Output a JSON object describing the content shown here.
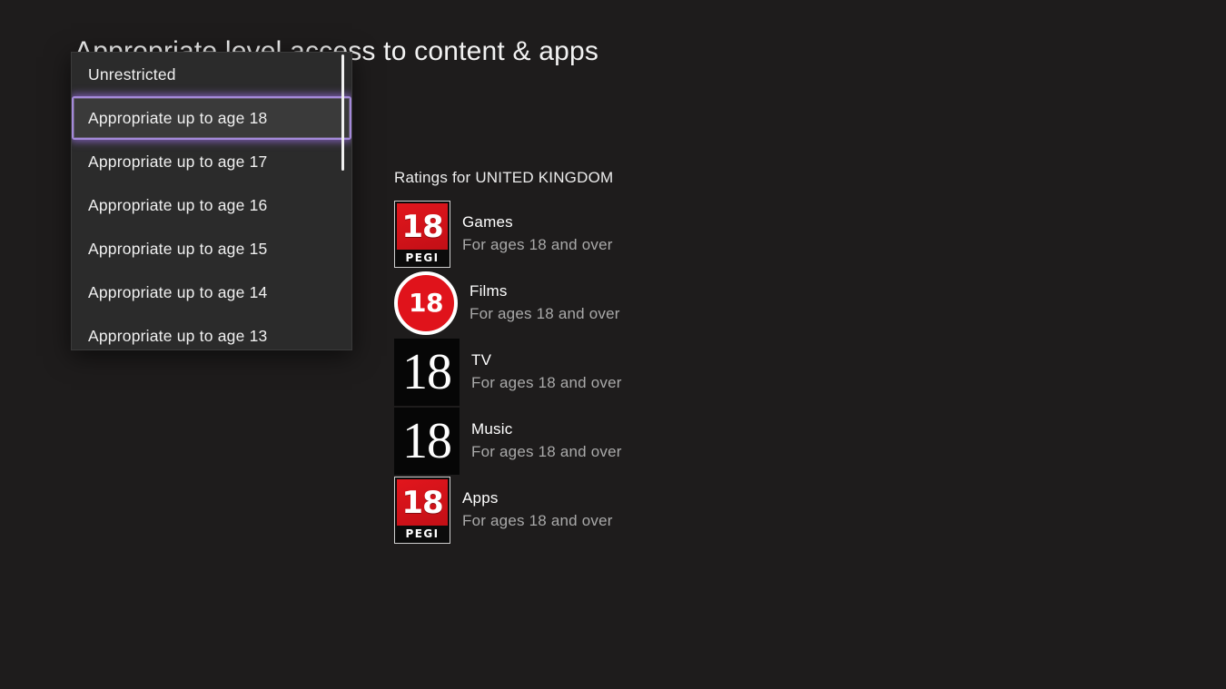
{
  "page": {
    "heading": "Appropriate level access to content & apps",
    "background_color": "#1e1c1c"
  },
  "dropdown": {
    "name": "age-rating-select",
    "selected_index": 1,
    "accent_color": "#a489d9",
    "panel_color": "#2b2b2b",
    "options": [
      {
        "label": "Unrestricted"
      },
      {
        "label": "Appropriate up to age 18"
      },
      {
        "label": "Appropriate up to age 17"
      },
      {
        "label": "Appropriate up to age 16"
      },
      {
        "label": "Appropriate up to age 15"
      },
      {
        "label": "Appropriate up to age 14"
      },
      {
        "label": "Appropriate up to age 13"
      }
    ]
  },
  "ratings": {
    "title": "Ratings for UNITED KINGDOM",
    "region": "UNITED KINGDOM",
    "items": [
      {
        "category": "Games",
        "description": "For ages 18 and over",
        "icon": "pegi-18-icon",
        "icon_style": "pegi",
        "icon_value": "18",
        "icon_band": "PEGI",
        "icon_color": "#d4121a"
      },
      {
        "category": "Films",
        "description": "For ages 18 and over",
        "icon": "bbfc-18-circle-icon",
        "icon_style": "circle",
        "icon_value": "18",
        "icon_color": "#e0131b"
      },
      {
        "category": "TV",
        "description": "For ages 18 and over",
        "icon": "tv-18-square-icon",
        "icon_style": "square",
        "icon_value": "18",
        "icon_color": "#060606"
      },
      {
        "category": "Music",
        "description": "For ages 18 and over",
        "icon": "music-18-square-icon",
        "icon_style": "square",
        "icon_value": "18",
        "icon_color": "#060606"
      },
      {
        "category": "Apps",
        "description": "For ages 18 and over",
        "icon": "pegi-18-icon",
        "icon_style": "pegi",
        "icon_value": "18",
        "icon_band": "PEGI",
        "icon_color": "#d4121a"
      }
    ]
  }
}
